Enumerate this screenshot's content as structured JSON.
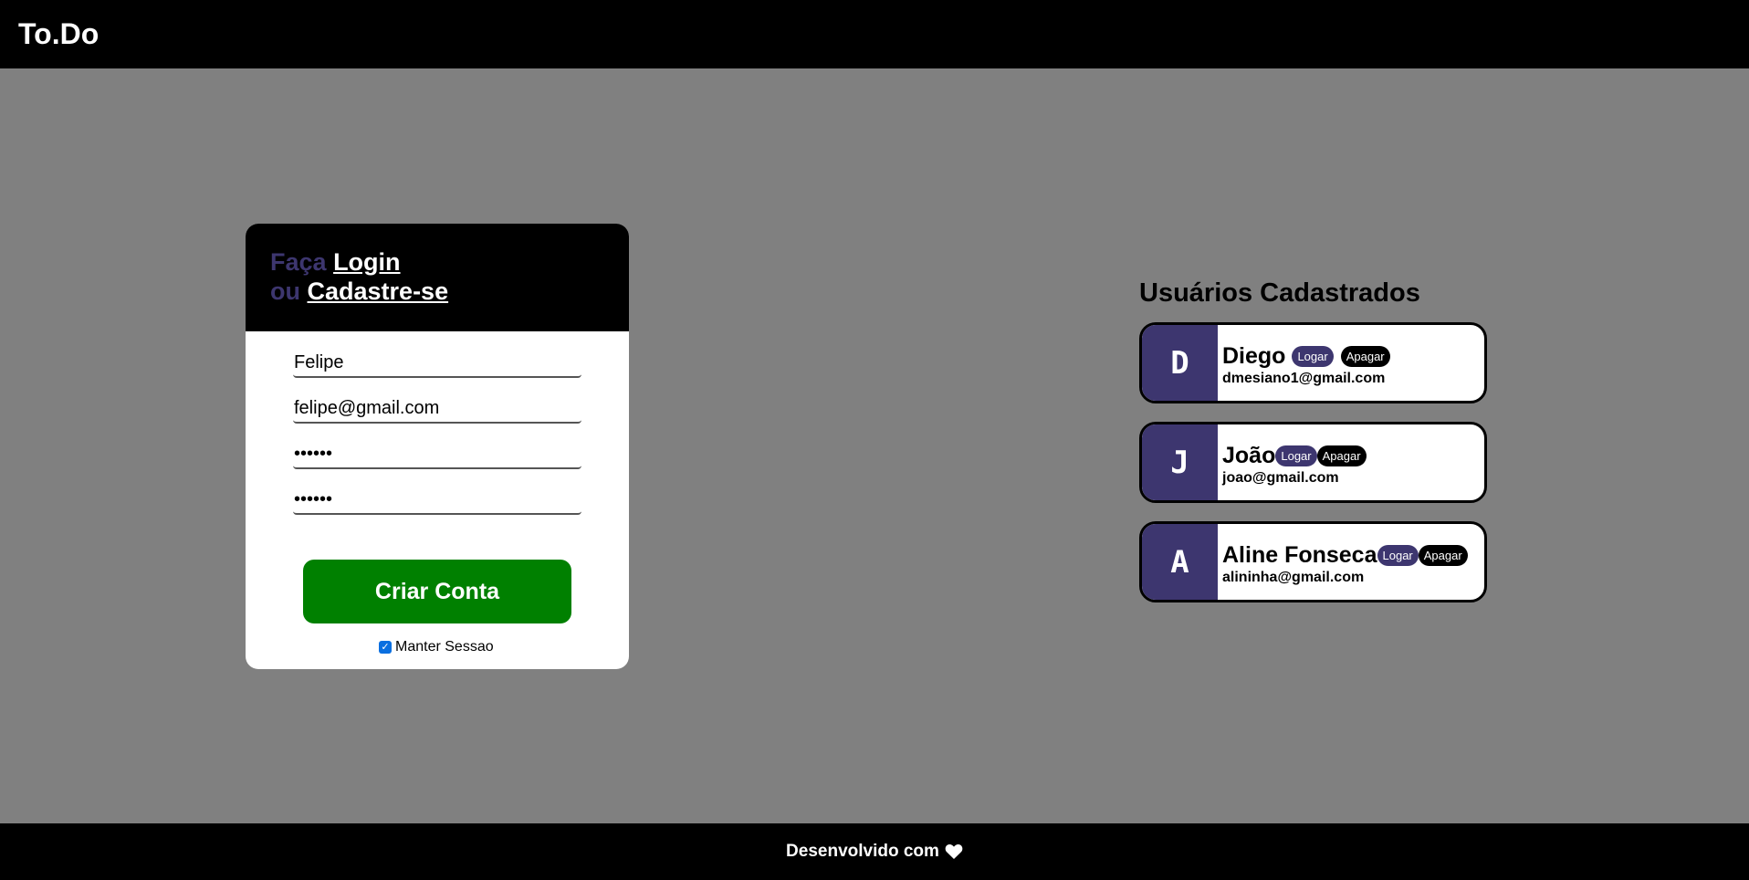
{
  "app": {
    "brand": "To.Do"
  },
  "login_card": {
    "heading_prefix": "Faça",
    "login_link": "Login",
    "heading_or": "ou",
    "signup_link": "Cadastre-se",
    "fields": {
      "name": "Felipe",
      "email": "felipe@gmail.com",
      "password": "••••••",
      "confirm_password": "••••••"
    },
    "submit_label": "Criar Conta",
    "keep_session_label": "Manter Sessao",
    "keep_session_checked": true
  },
  "users_panel": {
    "title": "Usuários Cadastrados",
    "login_label": "Logar",
    "delete_label": "Apagar",
    "users": [
      {
        "initial": "D",
        "name": "Diego",
        "email": "dmesiano1@gmail.com"
      },
      {
        "initial": "J",
        "name": "João",
        "email": "joao@gmail.com"
      },
      {
        "initial": "A",
        "name": "Aline Fonseca",
        "email": "alininha@gmail.com"
      }
    ]
  },
  "footer": {
    "text": "Desenvolvido com",
    "icon": "heart-icon"
  },
  "colors": {
    "accent": "#3d366f",
    "success": "#008000",
    "background": "#808080",
    "bar": "#000000"
  }
}
